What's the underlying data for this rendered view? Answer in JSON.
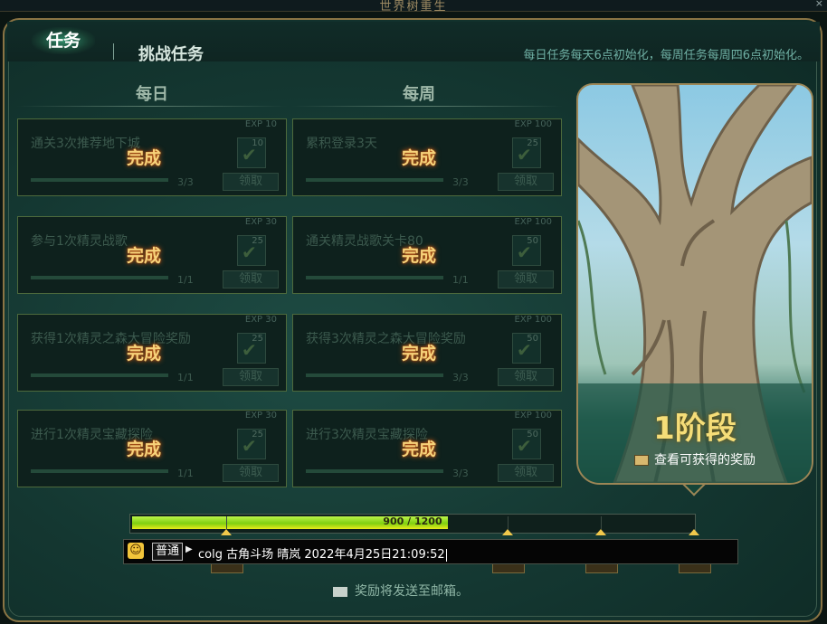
{
  "window": {
    "title": "世界树重生",
    "close": "×"
  },
  "tabs": [
    {
      "label": "任务",
      "active": true
    },
    {
      "label": "挑战任务",
      "active": false
    }
  ],
  "reset_note": "每日任务每天6点初始化，每周任务每周四6点初始化。",
  "columns": {
    "daily": "每日",
    "weekly": "每周"
  },
  "quests": {
    "daily": [
      {
        "name": "通关3次推荐地下城",
        "exp": "EXP 10",
        "reward_count": "10",
        "progress": "3/3",
        "claim": "领取",
        "status": "完成"
      },
      {
        "name": "参与1次精灵战歌",
        "exp": "EXP 30",
        "reward_count": "25",
        "progress": "1/1",
        "claim": "领取",
        "status": "完成"
      },
      {
        "name": "获得1次精灵之森大冒险奖励",
        "exp": "EXP 30",
        "reward_count": "25",
        "progress": "1/1",
        "claim": "领取",
        "status": "完成"
      },
      {
        "name": "进行1次精灵宝藏探险",
        "exp": "EXP 30",
        "reward_count": "25",
        "progress": "1/1",
        "claim": "领取",
        "status": "完成"
      }
    ],
    "weekly": [
      {
        "name": "累积登录3天",
        "exp": "EXP 100",
        "reward_count": "25",
        "progress": "3/3",
        "claim": "领取",
        "status": "完成"
      },
      {
        "name": "通关精灵战歌关卡80",
        "exp": "EXP 100",
        "reward_count": "50",
        "progress": "1/1",
        "claim": "领取",
        "status": "完成"
      },
      {
        "name": "获得3次精灵之森大冒险奖励",
        "exp": "EXP 100",
        "reward_count": "50",
        "progress": "3/3",
        "claim": "领取",
        "status": "完成"
      },
      {
        "name": "进行3次精灵宝藏探险",
        "exp": "EXP 100",
        "reward_count": "50",
        "progress": "3/3",
        "claim": "领取",
        "status": "完成"
      }
    ]
  },
  "tree_panel": {
    "stage": "1阶段",
    "reward_link": "查看可获得的奖励"
  },
  "progress": {
    "current": 900,
    "max": 1200,
    "label": "900 / 1200"
  },
  "chat": {
    "channel": "普通",
    "message": "colg 古角斗场 晴岚 2022年4月25日21:09:52"
  },
  "mail_note": "奖励将发送至邮箱。",
  "colors": {
    "done_text": "#f6d27a",
    "progress_fill": "#bdf44a",
    "frame_gold": "#8a7444"
  }
}
